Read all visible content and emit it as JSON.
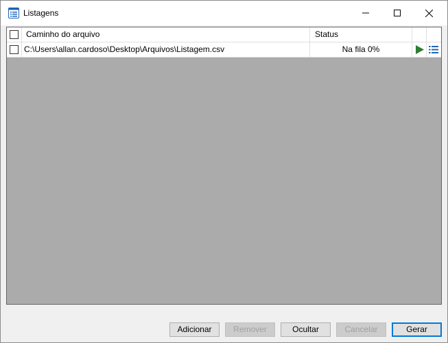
{
  "window": {
    "title": "Listagens",
    "controls": [
      "minimize",
      "maximize",
      "close"
    ]
  },
  "grid": {
    "columns": {
      "file_path": "Caminho do arquivo",
      "status": "Status"
    },
    "rows": [
      {
        "checked": false,
        "file_path": "C:\\Users\\allan.cardoso\\Desktop\\Arquivos\\Listagem.csv",
        "status": "Na fila 0%",
        "actions": [
          "play-icon",
          "list-icon"
        ]
      }
    ]
  },
  "buttons": {
    "add": "Adicionar",
    "remove": "Remover",
    "hide": "Ocultar",
    "cancel": "Cancelar",
    "generate": "Gerar"
  },
  "colors": {
    "accent": "#0078d7",
    "play": "#2e7d32",
    "list": "#1e63b8",
    "grid_bg": "#ababab"
  }
}
